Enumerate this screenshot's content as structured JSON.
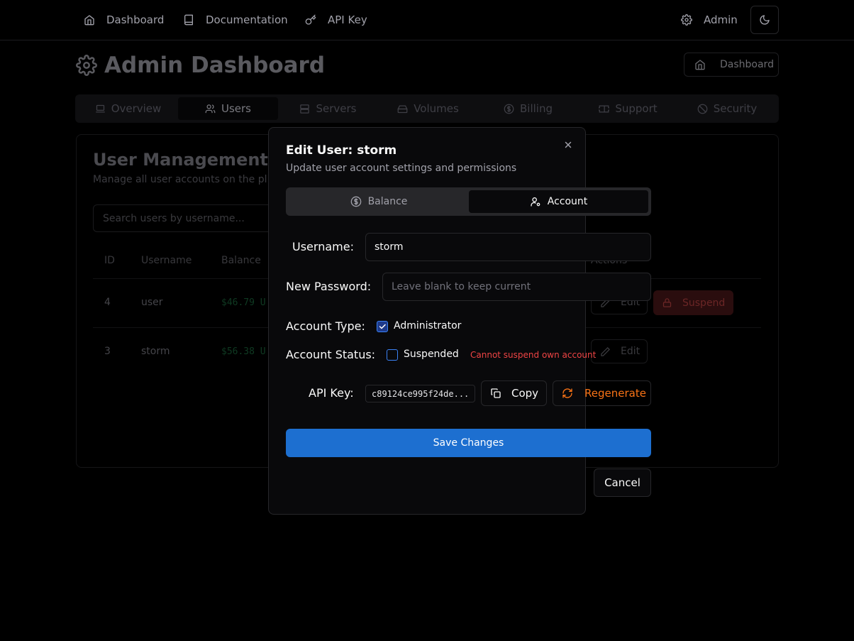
{
  "colors": {
    "background": "#000000",
    "modal_bg": "#09090b",
    "primary_button": "#1d6fd0",
    "warning_text": "#ef4444",
    "regenerate_text": "#f97316",
    "checkbox_accent": "#3b82f6"
  },
  "topnav": {
    "links": [
      {
        "label": "Dashboard",
        "icon": "home-icon"
      },
      {
        "label": "Documentation",
        "icon": "book-icon"
      },
      {
        "label": "API Key",
        "icon": "key-icon"
      }
    ],
    "admin_label": "Admin",
    "admin_icon": "gear-icon",
    "theme_icon": "moon-icon"
  },
  "header": {
    "title": "Admin Dashboard",
    "title_icon": "gear-icon",
    "dashboard_button": "Dashboard"
  },
  "tabs": [
    {
      "label": "Overview",
      "icon": "laptop-icon",
      "active": false
    },
    {
      "label": "Users",
      "icon": "users-icon",
      "active": true
    },
    {
      "label": "Servers",
      "icon": "server-icon",
      "active": false
    },
    {
      "label": "Volumes",
      "icon": "hard-drive-icon",
      "active": false
    },
    {
      "label": "Billing",
      "icon": "dollar-circle-icon",
      "active": false
    },
    {
      "label": "Support",
      "icon": "ticket-icon",
      "active": false
    },
    {
      "label": "Security",
      "icon": "ban-icon",
      "active": false
    }
  ],
  "user_management": {
    "title": "User Management",
    "subtitle": "Manage all user accounts on the pl",
    "search_placeholder": "Search users by username...",
    "columns": [
      "ID",
      "Username",
      "Balance",
      "Actions"
    ],
    "rows": [
      {
        "id": "4",
        "username": "user",
        "balance": "$46.79 U",
        "edit": "Edit",
        "suspend": "Suspend"
      },
      {
        "id": "3",
        "username": "storm",
        "balance": "$56.38 U",
        "edit": "Edit"
      }
    ]
  },
  "modal": {
    "title": "Edit User: storm",
    "description": "Update user account settings and permissions",
    "tabs": [
      {
        "label": "Balance",
        "icon": "dollar-circle-icon",
        "active": false
      },
      {
        "label": "Account",
        "icon": "user-cog-icon",
        "active": true
      }
    ],
    "username_label": "Username:",
    "username_value": "storm",
    "password_label": "New Password:",
    "password_placeholder": "Leave blank to keep current",
    "account_type_label": "Account Type:",
    "administrator_label": "Administrator",
    "administrator_checked": true,
    "account_status_label": "Account Status:",
    "suspended_label": "Suspended",
    "suspended_checked": false,
    "suspend_warning": "Cannot suspend own account",
    "api_key_label": "API Key:",
    "api_key_value": "c89124ce995f24de...",
    "copy_label": "Copy",
    "regenerate_label": "Regenerate",
    "save_label": "Save Changes",
    "cancel_label": "Cancel"
  }
}
